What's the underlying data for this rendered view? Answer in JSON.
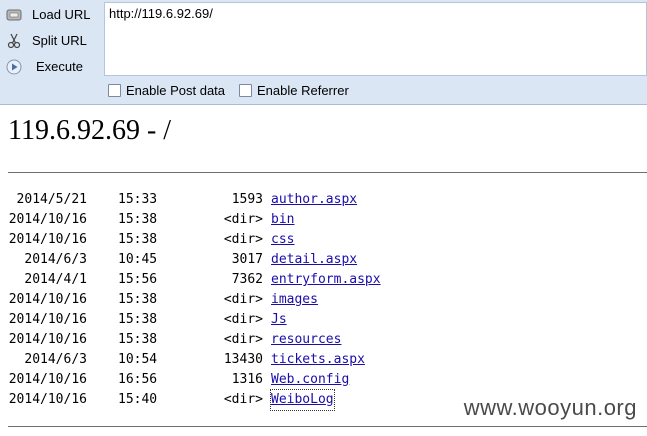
{
  "hackbar": {
    "buttons": [
      {
        "icon": "load-url-icon",
        "label": "Load URL"
      },
      {
        "icon": "scissors-icon",
        "label": "Split URL"
      },
      {
        "icon": "play-icon",
        "label": "Execute"
      }
    ],
    "url_value": "http://119.6.92.69/",
    "options": {
      "post": {
        "label": "Enable Post data",
        "checked": false
      },
      "referrer": {
        "label": "Enable Referrer",
        "checked": false
      }
    }
  },
  "page": {
    "title": "119.6.92.69 - /",
    "entries": [
      {
        "date": "2014/5/21",
        "time": "15:33",
        "size": "1593",
        "name": "author.aspx"
      },
      {
        "date": "2014/10/16",
        "time": "15:38",
        "size": "<dir>",
        "name": "bin"
      },
      {
        "date": "2014/10/16",
        "time": "15:38",
        "size": "<dir>",
        "name": "css"
      },
      {
        "date": "2014/6/3",
        "time": "10:45",
        "size": "3017",
        "name": "detail.aspx"
      },
      {
        "date": "2014/4/1",
        "time": "15:56",
        "size": "7362",
        "name": "entryform.aspx"
      },
      {
        "date": "2014/10/16",
        "time": "15:38",
        "size": "<dir>",
        "name": "images"
      },
      {
        "date": "2014/10/16",
        "time": "15:38",
        "size": "<dir>",
        "name": "Js"
      },
      {
        "date": "2014/10/16",
        "time": "15:38",
        "size": "<dir>",
        "name": "resources"
      },
      {
        "date": "2014/6/3",
        "time": "10:54",
        "size": "13430",
        "name": "tickets.aspx"
      },
      {
        "date": "2014/10/16",
        "time": "16:56",
        "size": "1316",
        "name": "Web.config"
      },
      {
        "date": "2014/10/16",
        "time": "15:40",
        "size": "<dir>",
        "name": "WeiboLog"
      }
    ]
  },
  "watermark": "www.wooyun.org",
  "colors": {
    "link": "#1a0dab",
    "toolbar_bg": "#dbe6f4"
  }
}
